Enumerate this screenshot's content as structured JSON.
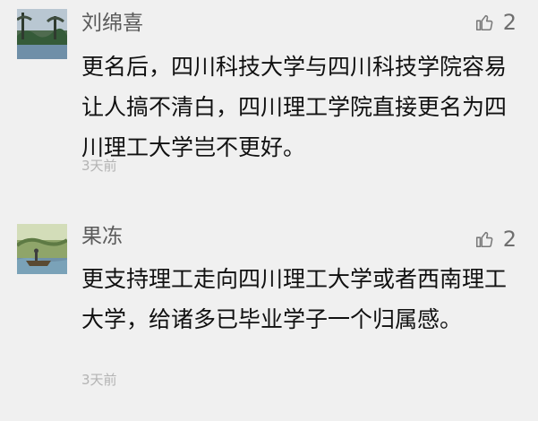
{
  "comments": [
    {
      "author": "刘绵喜",
      "likes": "2",
      "text": "更名后，四川科技大学与四川科技学院容易让人搞不清白，四川理工学院直接更名为四川理工大学岂不更好。",
      "time": "3天前",
      "avatar_icon": "landscape-avatar"
    },
    {
      "author": "果冻",
      "likes": "2",
      "text": "更支持理工走向四川理工大学或者西南理工大学，给诸多已毕业学子一个归属感。",
      "time": "3天前",
      "avatar_icon": "lake-boat-avatar"
    }
  ],
  "icons": {
    "like": "thumbs-up-icon"
  },
  "colors": {
    "background": "#f0f0f0",
    "author": "#5b5b5b",
    "body_text": "#111111",
    "timestamp": "#b3b3b3",
    "like": "#6e6e6e"
  }
}
